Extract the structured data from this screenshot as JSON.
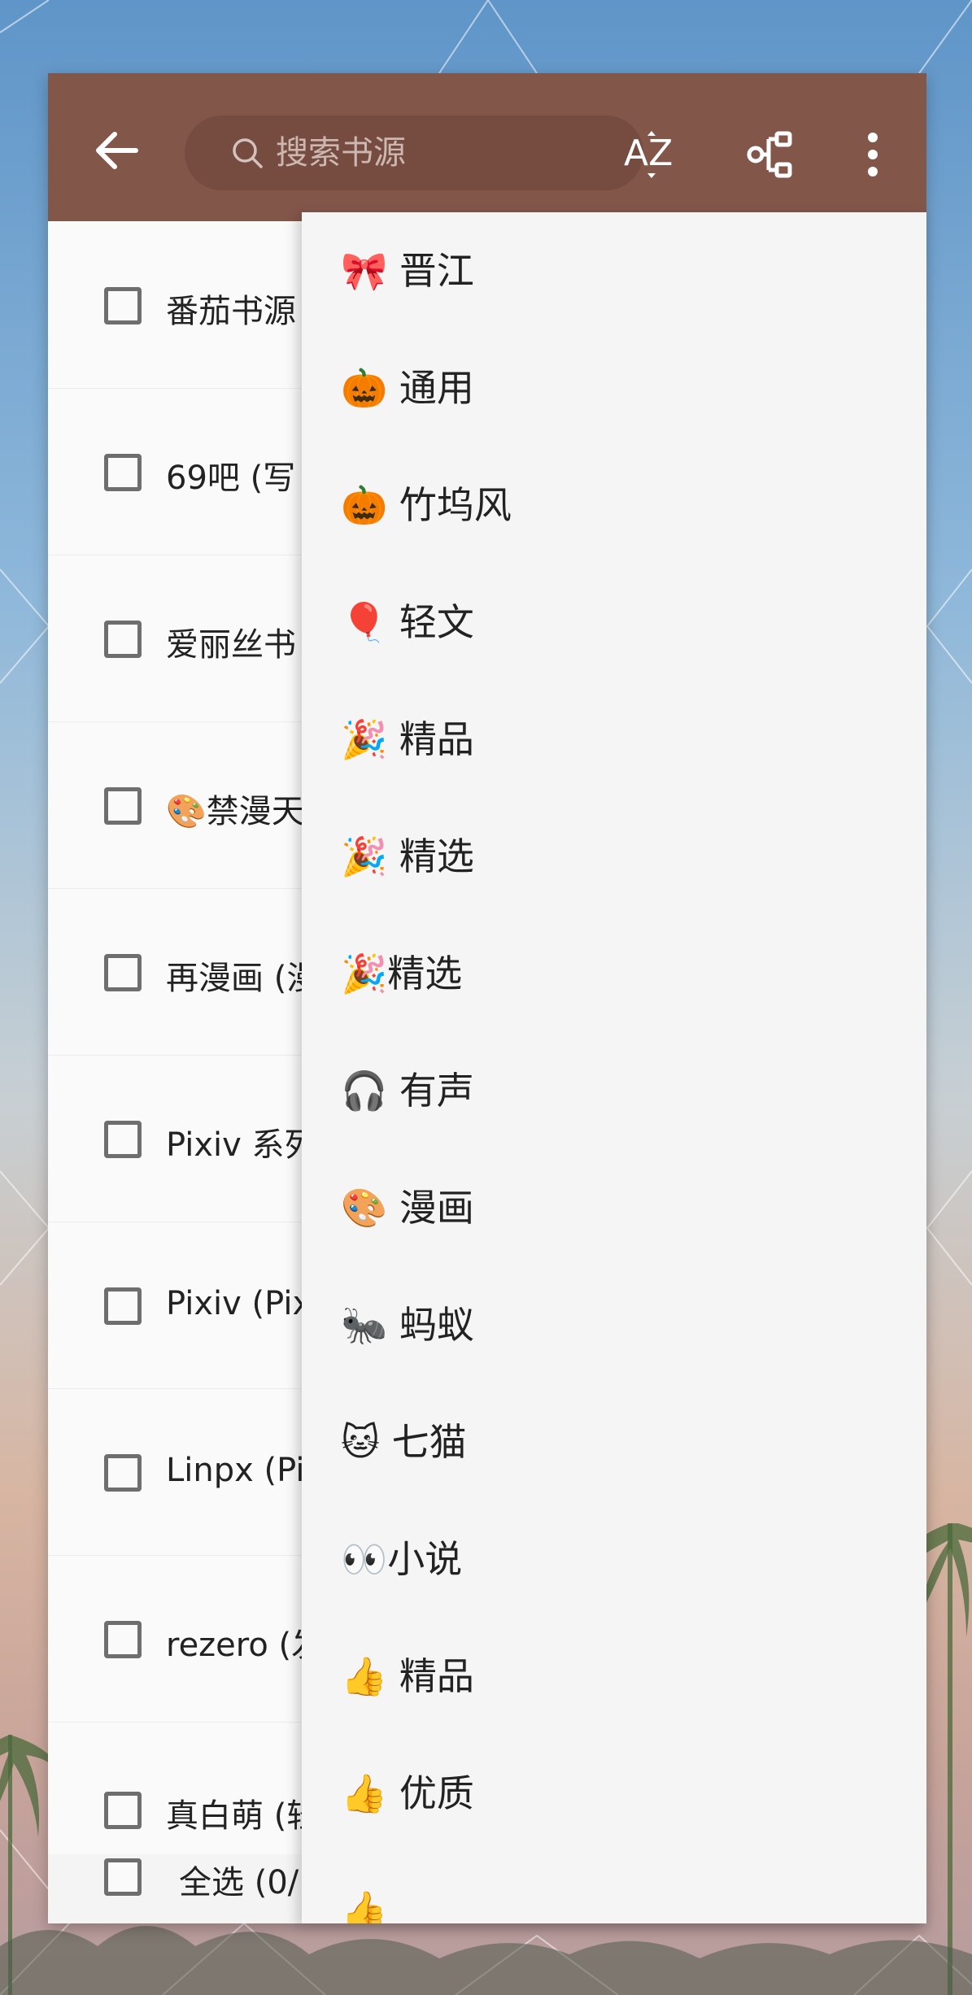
{
  "toolbar": {
    "search_placeholder": "搜索书源",
    "sort_label": "AZ"
  },
  "list": {
    "rows": [
      {
        "label": "番茄书源"
      },
      {
        "label": "69吧 (写"
      },
      {
        "label": "爱丽丝书"
      },
      {
        "label": "🎨禁漫天"
      },
      {
        "label": "再漫画 (漫"
      },
      {
        "label": "Pixiv 系列"
      },
      {
        "label": "Pixiv (Pix"
      },
      {
        "label": "Linpx (Pi"
      },
      {
        "label": "rezero (发"
      },
      {
        "label": "真白萌 (轻"
      }
    ],
    "select_all_label": "全选 (0/"
  },
  "menu": {
    "items": [
      {
        "label": "🎀 晋江"
      },
      {
        "label": "🎃 通用"
      },
      {
        "label": "🎃 竹坞风"
      },
      {
        "label": "🎈 轻文"
      },
      {
        "label": "🎉 精品"
      },
      {
        "label": "🎉 精选"
      },
      {
        "label": "🎉精选"
      },
      {
        "label": "🎧 有声"
      },
      {
        "label": "🎨 漫画"
      },
      {
        "label": "🐜 蚂蚁"
      },
      {
        "label": "🐱 七猫"
      },
      {
        "label": "👀小说"
      },
      {
        "label": "👍 精品"
      },
      {
        "label": "👍 优质"
      },
      {
        "label": "👍"
      }
    ]
  },
  "colors": {
    "toolbar": "#83564a",
    "search_bg": "#764c41",
    "dialog_bg": "#fafafa",
    "menu_bg": "#f5f5f5"
  }
}
